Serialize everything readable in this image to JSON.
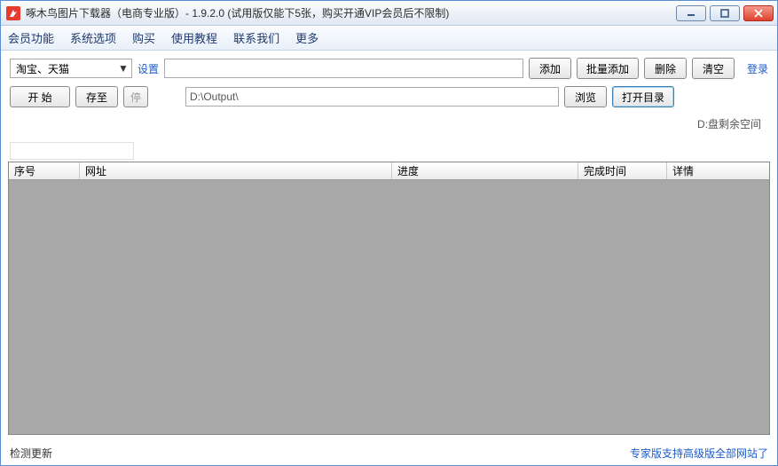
{
  "window": {
    "title": "啄木鸟图片下载器（电商专业版）- 1.9.2.0 (试用版仅能下5张，购买开通VIP会员后不限制)"
  },
  "menubar": [
    "会员功能",
    "系统选项",
    "购买",
    "使用教程",
    "联系我们",
    "更多"
  ],
  "row1": {
    "platform_selected": "淘宝、天猫",
    "settings_label": "设置",
    "url_value": "",
    "add": "添加",
    "batch_add": "批量添加",
    "delete": "删除",
    "clear": "清空",
    "login": "登录"
  },
  "row2": {
    "start": "开  始",
    "save_to": "存至",
    "stop": "停",
    "output_path": "D:\\Output\\",
    "browse": "浏览",
    "open_dir": "打开目录"
  },
  "disk_info": "D:盘剩余空间",
  "columns": {
    "seq": "序号",
    "url": "网址",
    "progress": "进度",
    "done_time": "完成时间",
    "detail": "详情"
  },
  "footer": {
    "check_update": "检测更新",
    "pro_notice": "专家版支持高级版全部网站了"
  }
}
